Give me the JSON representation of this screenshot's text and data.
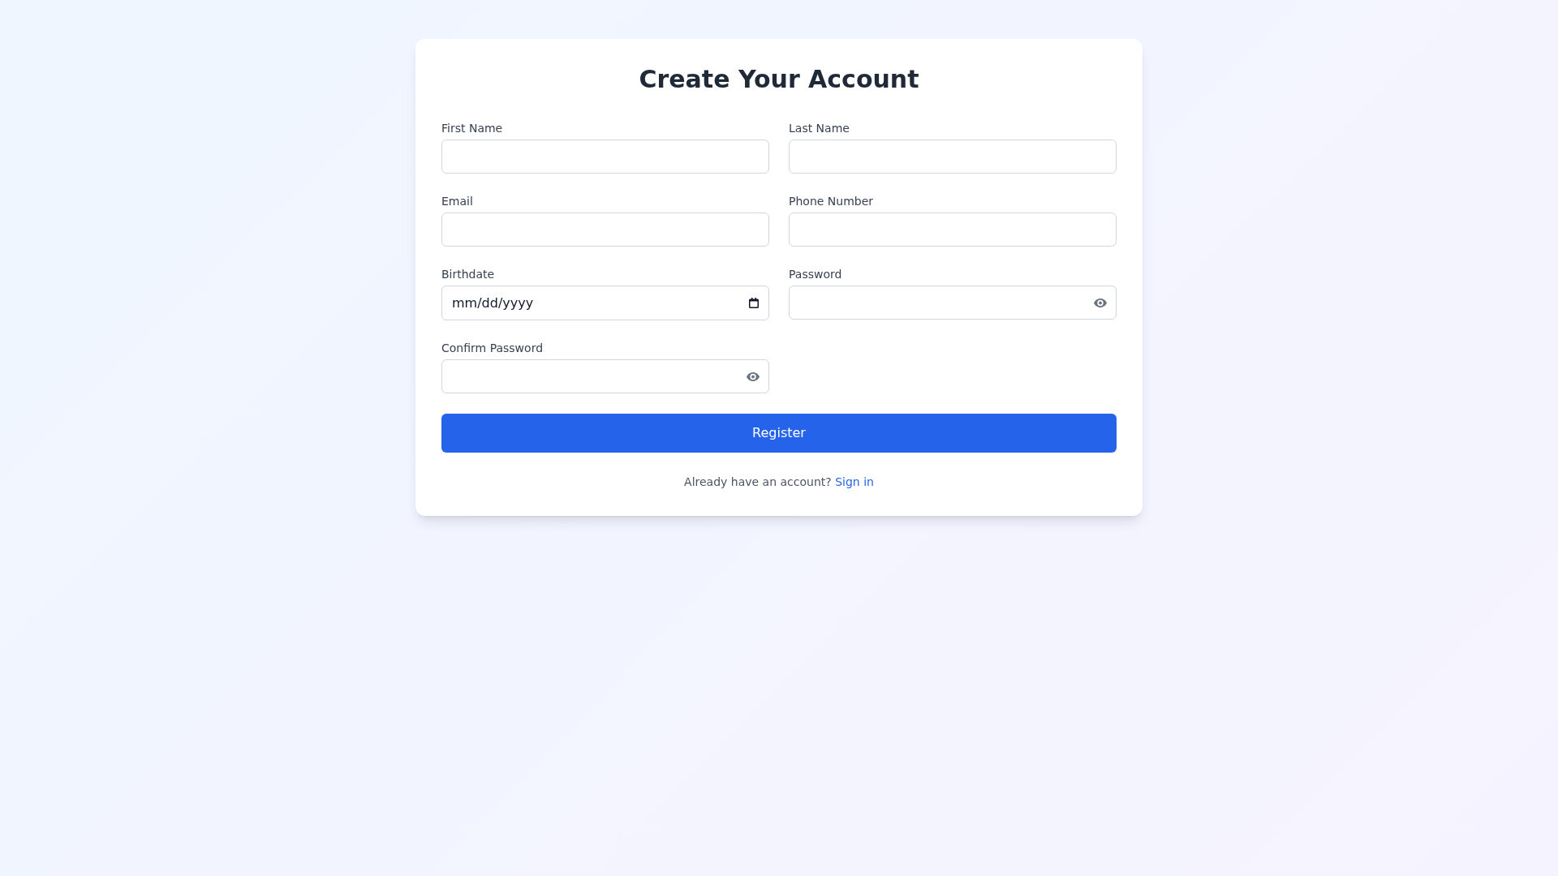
{
  "title": "Create Your Account",
  "fields": [
    {
      "label": "First Name",
      "kind": "text"
    },
    {
      "label": "Last Name",
      "kind": "text"
    },
    {
      "label": "Email",
      "kind": "text"
    },
    {
      "label": "Phone Number",
      "kind": "text"
    },
    {
      "label": "Birthdate",
      "kind": "date",
      "placeholder": "mm/dd/yyyy"
    },
    {
      "label": "Password",
      "kind": "password"
    },
    {
      "label": "Confirm Password",
      "kind": "password"
    }
  ],
  "submit_button": "Register",
  "footer": {
    "text": "Already have an account?",
    "link": "Sign in"
  }
}
